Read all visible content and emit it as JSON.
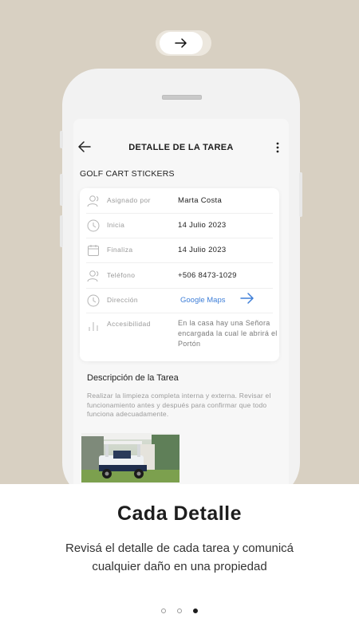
{
  "colors": {
    "background_top": "#d8d0c2",
    "link": "#3f7fd8",
    "text_dark": "#1d1d1d"
  },
  "next_button": {
    "icon": "arrow-right-icon"
  },
  "screen": {
    "title": "DETALLE DE LA TAREA",
    "task_name": "GOLF CART STICKERS",
    "details": [
      {
        "icon": "user-icon",
        "label": "Asignado por",
        "value": "Marta Costa"
      },
      {
        "icon": "clock-icon",
        "label": "Inicia",
        "value": "14 Julio 2023"
      },
      {
        "icon": "calendar-icon",
        "label": "Finaliza",
        "value": "14 Julio 2023"
      },
      {
        "icon": "user-icon",
        "label": "Teléfono",
        "value": "+506 8473-1029"
      },
      {
        "icon": "clock-icon",
        "label": "Dirección",
        "value": "Google Maps"
      },
      {
        "icon": "bar-chart-icon",
        "label": "Accesibilidad",
        "value": "En la casa hay una Señora encargada la cual le abrirá el Portón"
      }
    ],
    "description_title": "Descripción de la Tarea",
    "description_text": "Realizar la limpieza completa interna y externa. Revisar el funcionamiento antes y después para confirmar que todo funciona adecuadamente."
  },
  "onboarding": {
    "headline": "Cada Detalle",
    "subtitle": "Revisá el detalle de cada tarea y comunicá cualquier daño en una propiedad",
    "page_count": 3,
    "active_page": 3
  }
}
